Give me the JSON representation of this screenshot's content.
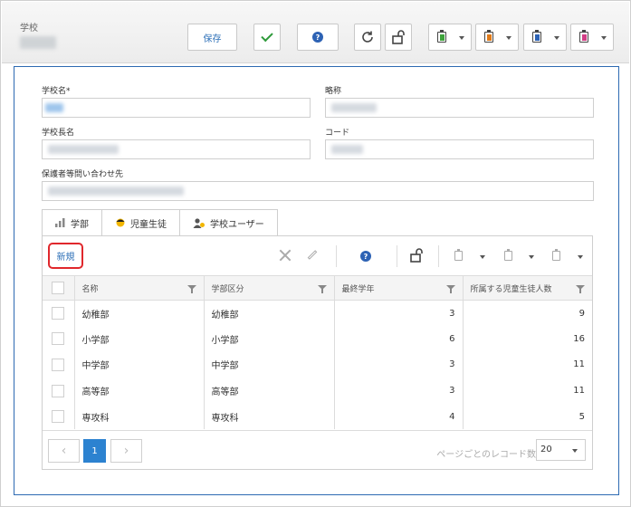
{
  "header": {
    "title": "学校",
    "buttons": {
      "save_label": "保存",
      "confirm_icon": "check-icon",
      "help_label": "?",
      "refresh_icon": "refresh-icon",
      "unlock_icon": "unlock-icon"
    },
    "clip_colors": [
      "#3ea33b",
      "#e07b1a",
      "#2d62b4",
      "#d23f86"
    ]
  },
  "form": {
    "school_name_label": "学校名*",
    "abbr_label": "略称",
    "principal_label": "学校長名",
    "code_label": "コード",
    "guardian_contact_label": "保護者等問い合わせ先"
  },
  "tabs": [
    {
      "label": "学部",
      "icon": "bar-chart-icon"
    },
    {
      "label": "児童生徒",
      "icon": "student-icon"
    },
    {
      "label": "学校ユーザー",
      "icon": "users-icon"
    }
  ],
  "grid": {
    "new_label": "新規",
    "help_label": "?",
    "columns": [
      "名称",
      "学部区分",
      "最終学年",
      "所属する児童生徒人数"
    ],
    "rows": [
      {
        "name": "幼稚部",
        "category": "幼稚部",
        "final_grade": "3",
        "students": "9"
      },
      {
        "name": "小学部",
        "category": "小学部",
        "final_grade": "6",
        "students": "16"
      },
      {
        "name": "中学部",
        "category": "中学部",
        "final_grade": "3",
        "students": "11"
      },
      {
        "name": "高等部",
        "category": "高等部",
        "final_grade": "3",
        "students": "11"
      },
      {
        "name": "専攻科",
        "category": "専攻科",
        "final_grade": "4",
        "students": "5"
      }
    ],
    "pager": {
      "prev": "‹",
      "current_page": "1",
      "next": "›",
      "page_size_label": "ページごとのレコード数",
      "page_size": "20"
    }
  }
}
